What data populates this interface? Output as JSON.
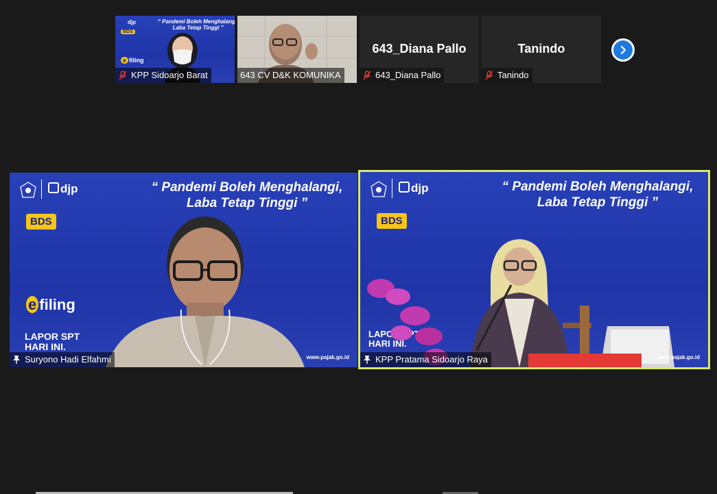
{
  "gallery": {
    "thumbs": [
      {
        "name": "KPP Sidoarjo Barat",
        "muted": true
      },
      {
        "name": "643 CV D&K KOMUNIKA",
        "muted": false
      },
      {
        "name": "643_Diana Pallo",
        "display": "643_Diana Pallo",
        "muted": true
      },
      {
        "name": "Tanindo",
        "display": "Tanindo",
        "muted": true
      }
    ]
  },
  "banner": {
    "title_line1": "“ Pandemi Boleh Menghalangi,",
    "title_line2": "Laba Tetap Tinggi ”",
    "djp": "djp",
    "bds": "BDS",
    "efiling": "filing",
    "efiling_e": "e",
    "lapor1": "LAPOR SPT",
    "lapor2": "HARI INI.",
    "site": "www.pajak.go.id"
  },
  "main": {
    "left": {
      "name": "Suryono Hadi Elfahmi"
    },
    "right": {
      "name": "KPP Pratama Sidoarjo Raya",
      "active": true
    }
  },
  "colors": {
    "background": "#1a1a1a",
    "banner_blue": "#2840b8",
    "active_border": "#d8e86a",
    "next_button": "#1f7ae0"
  }
}
